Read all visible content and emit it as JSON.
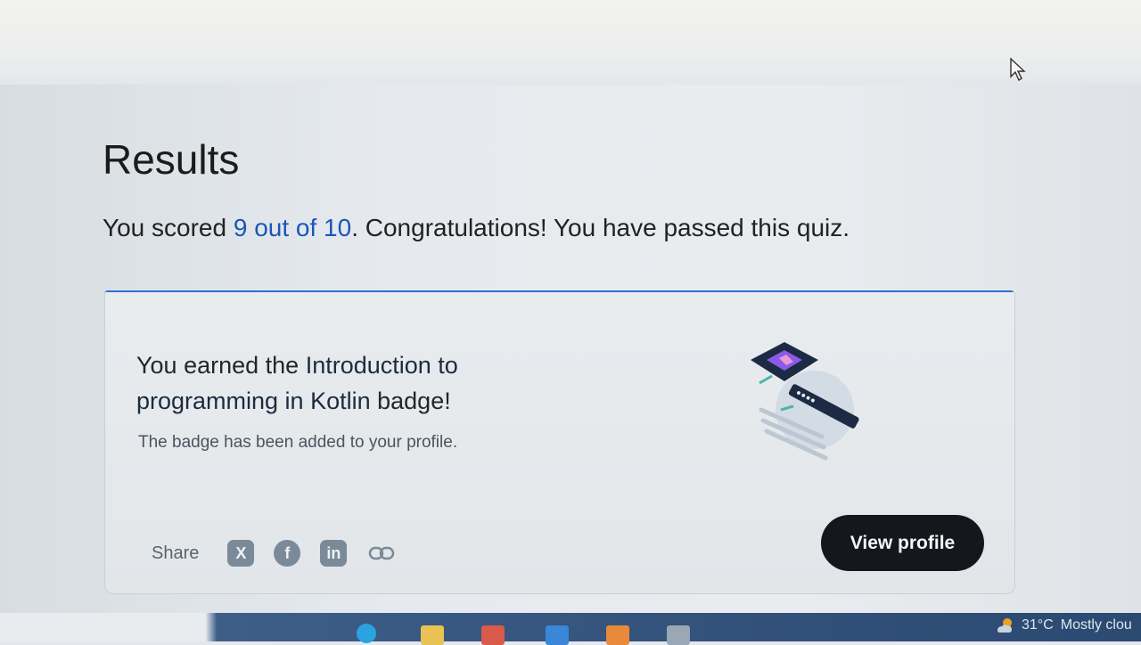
{
  "page": {
    "title": "Results",
    "score_prefix": "You scored ",
    "score_value": "9 out of 10",
    "score_suffix": ". Congratulations! You have passed this quiz."
  },
  "badge": {
    "title_pre": "You earned the ",
    "title_name": "Introduction to programming in Kotlin",
    "title_post": " badge!",
    "subtitle": "The badge has been added to your profile."
  },
  "share": {
    "label": "Share",
    "items": [
      {
        "icon": "x-icon",
        "glyph": "X"
      },
      {
        "icon": "facebook-icon",
        "glyph": "f"
      },
      {
        "icon": "linkedin-icon",
        "glyph": "in"
      },
      {
        "icon": "link-icon",
        "glyph": ""
      }
    ]
  },
  "actions": {
    "view_profile": "View profile"
  },
  "taskbar": {
    "temperature": "31°C",
    "weather": "Mostly clou"
  },
  "colors": {
    "accent": "#2f6fd6",
    "score_text": "#1a56b8",
    "button_bg": "#14181c"
  }
}
